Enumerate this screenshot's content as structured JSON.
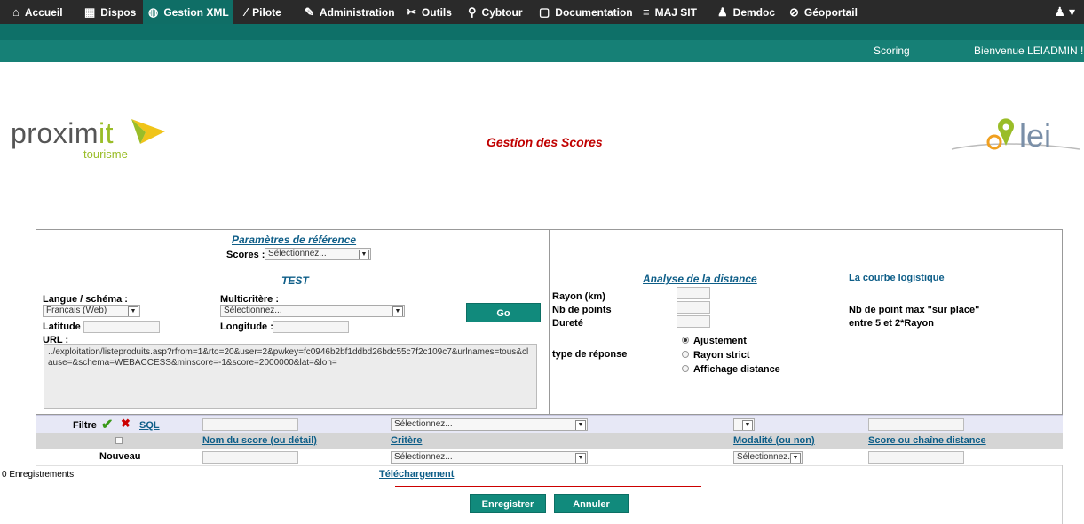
{
  "nav": {
    "items": [
      {
        "label": "Accueil",
        "icon": "home-icon"
      },
      {
        "label": "Dispos",
        "icon": "calendar-icon"
      },
      {
        "label": "Gestion XML",
        "icon": "globe-icon"
      },
      {
        "label": "Pilote",
        "icon": "magic-wand-icon"
      },
      {
        "label": "Administration",
        "icon": "tools-icon"
      },
      {
        "label": "Outils",
        "icon": "wrench-icon"
      },
      {
        "label": "Cybtour",
        "icon": "search-icon"
      },
      {
        "label": "Documentation",
        "icon": "document-icon"
      },
      {
        "label": "MAJ SIT",
        "icon": "update-icon"
      },
      {
        "label": "Demdoc",
        "icon": "users-icon"
      },
      {
        "label": "Géoportail",
        "icon": "compass-icon"
      }
    ],
    "active": "Gestion XML"
  },
  "subbar": {
    "scoring": "Scoring",
    "welcome": "Bienvenue LEIADMIN !"
  },
  "branding": {
    "left_logo_main": "proxim",
    "left_logo_it": "it",
    "left_logo_sub": "tourisme",
    "right_logo": "lei"
  },
  "page_title": "Gestion des Scores",
  "params": {
    "title": "Paramètres de référence",
    "scores_label": "Scores :",
    "scores_value": "Sélectionnez...",
    "test_title": "TEST",
    "langue_label": "Langue / schéma :",
    "langue_value": "Français (Web)",
    "multicritere_label": "Multicritère :",
    "multicritere_value": "Sélectionnez...",
    "go_button": "Go",
    "latitude_label": "Latitude :",
    "longitude_label": "Longitude :",
    "url_label": "URL :",
    "url_value": "../exploitation/listeproduits.asp?rfrom=1&rto=20&user=2&pwkey=fc0946b2bf1ddbd26bdc55c7f2c109c7&urlnames=tous&clause=&schema=WEBACCESS&minscore=-1&score=2000000&lat=&lon="
  },
  "distance": {
    "title": "Analyse de la distance",
    "logistic_link": "La courbe logistique",
    "rayon_label": "Rayon (km)",
    "nb_points_label": "Nb de points",
    "durete_label": "Dureté",
    "max_points_text": "Nb de point max \"sur place\"",
    "range_text": "entre 5 et 2*Rayon",
    "response_type_label": "type de réponse",
    "options": [
      "Ajustement",
      "Rayon strict",
      "Affichage distance"
    ],
    "selected_option": "Ajustement"
  },
  "grid": {
    "filter_label": "Filtre",
    "sql_link": "SQL",
    "filter_criterion_value": "Sélectionnez...",
    "headers": [
      "Nom du score (ou détail)",
      "Critère",
      "Modalité (ou non)",
      "Score ou chaîne distance"
    ],
    "new_label": "Nouveau",
    "new_criterion_value": "Sélectionnez...",
    "new_modality_value": "Sélectionnez..."
  },
  "footer": {
    "records": "0 Enregistrements",
    "download_link": "Téléchargement",
    "save_button": "Enregistrer",
    "cancel_button": "Annuler"
  },
  "colors": {
    "nav_bg": "#2a2a2a",
    "accent": "#118a7c",
    "title_red": "#c00000",
    "link_blue": "#0e5e88"
  }
}
